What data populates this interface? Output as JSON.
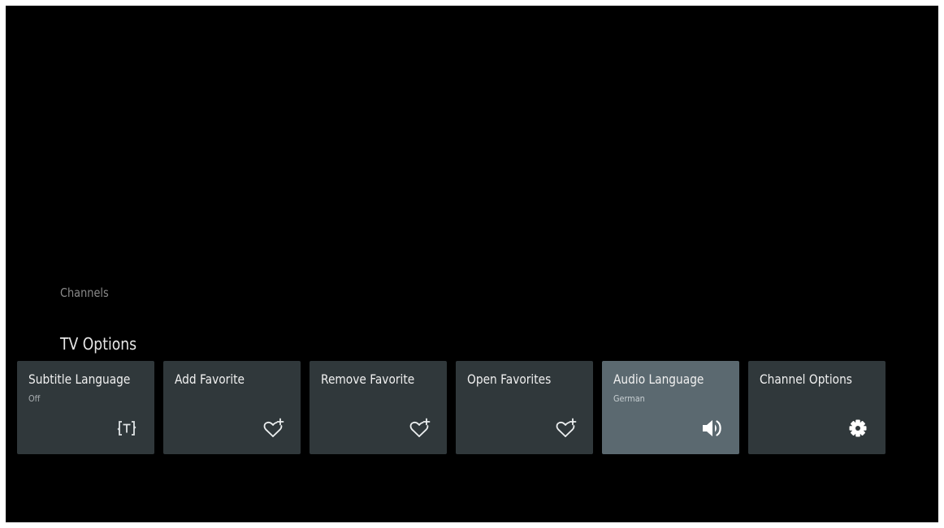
{
  "sections": {
    "channels": "Channels",
    "tv_options": "TV Options"
  },
  "tiles": [
    {
      "label": "Subtitle Language",
      "sub": "Off",
      "icon": "subtitle-icon"
    },
    {
      "label": "Add Favorite",
      "sub": "",
      "icon": "heart-plus-icon"
    },
    {
      "label": "Remove Favorite",
      "sub": "",
      "icon": "heart-plus-icon"
    },
    {
      "label": "Open Favorites",
      "sub": "",
      "icon": "heart-plus-icon"
    },
    {
      "label": "Audio Language",
      "sub": "German",
      "icon": "speaker-icon"
    },
    {
      "label": "Channel Options",
      "sub": "",
      "icon": "gear-icon"
    }
  ],
  "focused_tile": "Audio Language",
  "colors": {
    "background": "#000000",
    "tile": "#30383b",
    "tile_focused": "#5b6970",
    "text": "#f0f0f0",
    "subtext": "#a8adb0"
  }
}
